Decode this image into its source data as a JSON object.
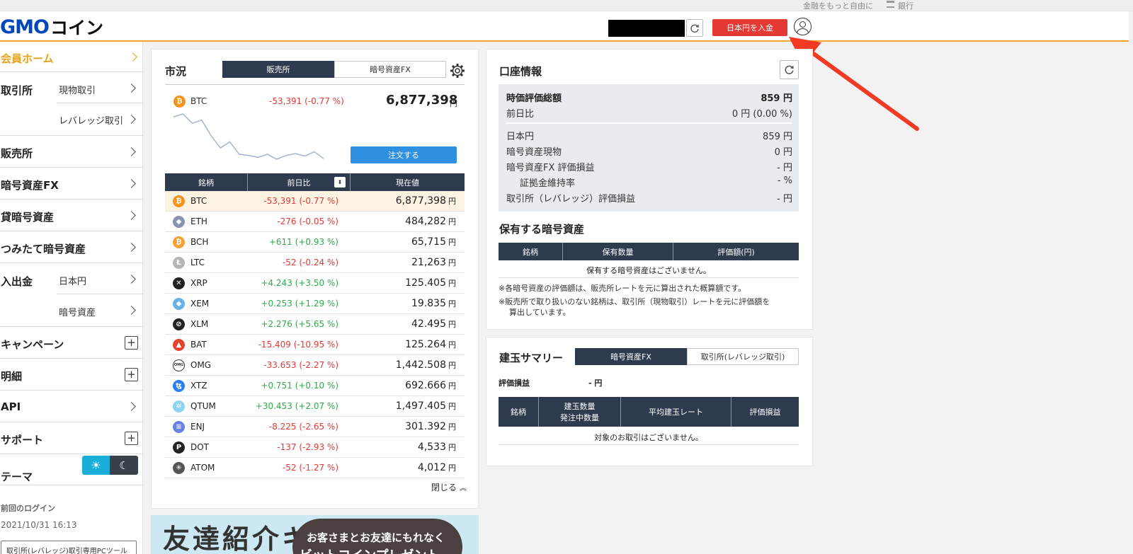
{
  "topbar": {
    "link1": "金融をもっと自由に",
    "link2": "銀行"
  },
  "header": {
    "logo_part1": "GMO",
    "logo_part2": "コイン",
    "deposit_label": "日本円を入金",
    "accent_color": "#f5a623"
  },
  "sidebar": {
    "home": "会員ホーム",
    "exchange": "取引所",
    "spot": "現物取引",
    "leverage": "レバレッジ取引",
    "dealer": "販売所",
    "fx": "暗号資産FX",
    "lending": "貸暗号資産",
    "tsumitate": "つみたて暗号資産",
    "deposit": "入出金",
    "jpy": "日本円",
    "crypto": "暗号資産",
    "campaign": "キャンペーン",
    "details": "明細",
    "api": "API",
    "support": "サポート",
    "theme": "テーマ",
    "last_login_label": "前回のログイン",
    "last_login_time": "2021/10/31 16:13",
    "tool_button": "取引所(レバレッジ)取引専用PCツール"
  },
  "market": {
    "title": "市況",
    "tab_dealer": "販売所",
    "tab_fx": "暗号資産FX",
    "top_symbol": "BTC",
    "top_change": "-53,391 (-0.77 %)",
    "top_price": "6,877,398",
    "yen": "円",
    "order_button": "注文する",
    "sparkline": [
      6.93,
      6.935,
      6.92,
      6.925,
      6.9,
      6.88,
      6.89,
      6.87,
      6.868,
      6.865,
      6.87,
      6.862,
      6.868,
      6.871,
      6.867,
      6.874,
      6.863
    ],
    "col_symbol": "銘柄",
    "col_change": "前日比",
    "col_price": "現在値",
    "close_label": "閉じる",
    "rows": [
      {
        "symbol": "BTC",
        "change": "-53,391 (-0.77 %)",
        "price": "6,877,398",
        "dir": "neg",
        "coin_color": "#f7931a",
        "coin_glyph": "₿"
      },
      {
        "symbol": "ETH",
        "change": "-276 (-0.05 %)",
        "price": "484,282",
        "dir": "neg",
        "coin_color": "#8a92b2",
        "coin_glyph": "◆"
      },
      {
        "symbol": "BCH",
        "change": "+611 (+0.93 %)",
        "price": "65,715",
        "dir": "pos",
        "coin_color": "#f7a035",
        "coin_glyph": "₿"
      },
      {
        "symbol": "LTC",
        "change": "-52 (-0.24 %)",
        "price": "21,263",
        "dir": "neg",
        "coin_color": "#b5b5b5",
        "coin_glyph": "Ł"
      },
      {
        "symbol": "XRP",
        "change": "+4.243 (+3.50 %)",
        "price": "125.405",
        "dir": "pos",
        "coin_color": "#222222",
        "coin_glyph": "✕"
      },
      {
        "symbol": "XEM",
        "change": "+0.253 (+1.29 %)",
        "price": "19.835",
        "dir": "pos",
        "coin_color": "#67b2e8",
        "coin_glyph": "◆"
      },
      {
        "symbol": "XLM",
        "change": "+2.276 (+5.65 %)",
        "price": "42.495",
        "dir": "pos",
        "coin_color": "#222222",
        "coin_glyph": "⊘"
      },
      {
        "symbol": "BAT",
        "change": "-15.409 (-10.95 %)",
        "price": "125.264",
        "dir": "neg",
        "coin_color": "#e5412c",
        "coin_glyph": "▲"
      },
      {
        "symbol": "OMG",
        "change": "-33.653 (-2.27 %)",
        "price": "1,442.508",
        "dir": "neg",
        "coin_color": "#ffffff",
        "coin_glyph": "OMG"
      },
      {
        "symbol": "XTZ",
        "change": "+0.751 (+0.10 %)",
        "price": "692.666",
        "dir": "pos",
        "coin_color": "#2c7df7",
        "coin_glyph": "ꜩ"
      },
      {
        "symbol": "QTUM",
        "change": "+30.453 (+2.07 %)",
        "price": "1,497.405",
        "dir": "pos",
        "coin_color": "#8fd3f4",
        "coin_glyph": "✲"
      },
      {
        "symbol": "ENJ",
        "change": "-8.225 (-2.65 %)",
        "price": "301.392",
        "dir": "neg",
        "coin_color": "#6a82e6",
        "coin_glyph": "≡"
      },
      {
        "symbol": "DOT",
        "change": "-137 (-2.93 %)",
        "price": "4,533",
        "dir": "neg",
        "coin_color": "#222222",
        "coin_glyph": "P"
      },
      {
        "symbol": "ATOM",
        "change": "-52 (-1.27 %)",
        "price": "4,012",
        "dir": "neg",
        "coin_color": "#555555",
        "coin_glyph": "✳"
      }
    ]
  },
  "banner": {
    "headline": "友達紹介キャンペーン",
    "pill1": "お客さまとお友達にもれなく",
    "pill2": "ビットコインプレゼント"
  },
  "account": {
    "title": "口座情報",
    "total_label": "時価評価総額",
    "total_value": "859 円",
    "prev_label": "前日比",
    "prev_value": "0 円 (0.00 %)",
    "jpy_label": "日本円",
    "jpy_value": "859 円",
    "spot_label": "暗号資産現物",
    "spot_value": "0 円",
    "fx_label": "暗号資産FX 評価損益",
    "fx_value": "- 円",
    "margin_label": "証拠金維持率",
    "margin_value": "- %",
    "lev_label": "取引所（レバレッジ）評価損益",
    "lev_value": "- 円",
    "holdings_title": "保有する暗号資産",
    "h_col1": "銘柄",
    "h_col2": "保有数量",
    "h_col3": "評価額(円)",
    "h_empty": "保有する暗号資産はございません。",
    "note1": "※各暗号資産の評価額は、販売所レートを元に算出された概算額です。",
    "note2": "※販売所で取り扱いのない銘柄は、取引所（現物取引）レートを元に評価額を",
    "note3": "算出しています。"
  },
  "positions": {
    "title": "建玉サマリー",
    "tab_fx": "暗号資産FX",
    "tab_lev": "取引所(レバレッジ取引)",
    "pl_label": "評価損益",
    "pl_value": "- 円",
    "col1": "銘柄",
    "col2a": "建玉数量",
    "col2b": "発注中数量",
    "col3": "平均建玉レート",
    "col4": "評価損益",
    "empty": "対象のお取引はございません。"
  }
}
